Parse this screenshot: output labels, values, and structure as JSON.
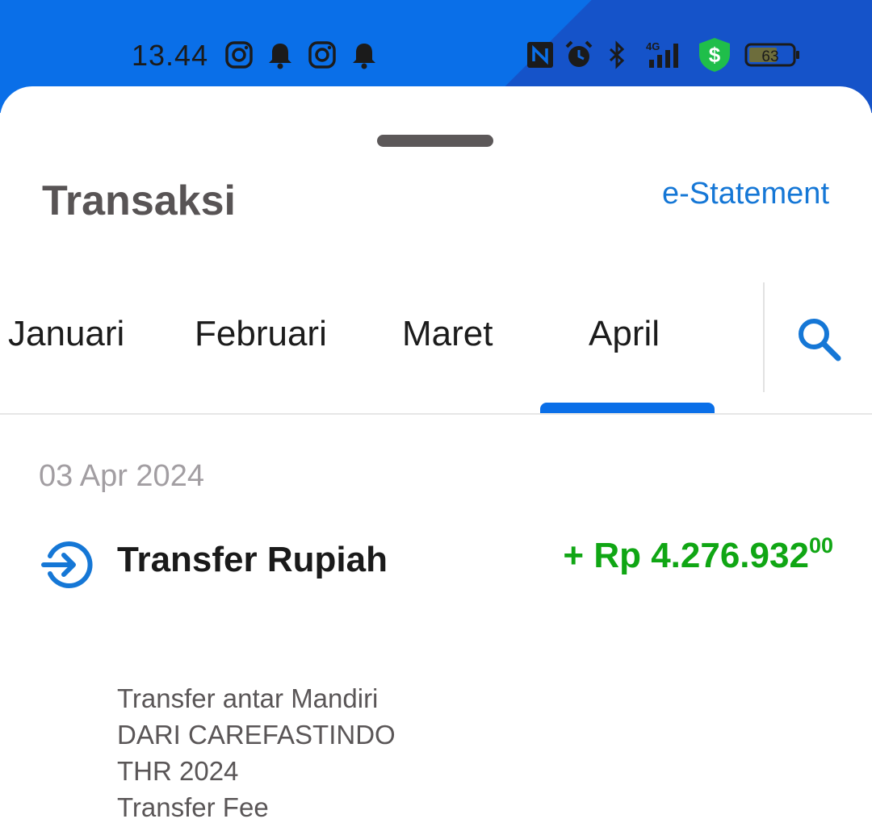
{
  "status_bar": {
    "time": "13.44",
    "battery": "63",
    "network": "4G",
    "icons": [
      "instagram-icon",
      "notification-bell-icon",
      "instagram-icon",
      "notification-bell-icon",
      "nfc-icon",
      "alarm-icon",
      "bluetooth-icon",
      "signal-icon",
      "money-shield-icon",
      "battery-icon"
    ]
  },
  "header": {
    "title": "Transaksi",
    "link_label": "e-Statement"
  },
  "tabs": [
    {
      "label": "Januari"
    },
    {
      "label": "Februari"
    },
    {
      "label": "Maret"
    },
    {
      "label": "April",
      "active": true
    }
  ],
  "transactions": {
    "date": "03 Apr 2024",
    "items": [
      {
        "title": "Transfer Rupiah",
        "amount_main": "+ Rp 4.276.932",
        "amount_cents": "00",
        "description": [
          "Transfer antar Mandiri",
          "DARI CAREFASTINDO",
          "THR 2024",
          "Transfer Fee"
        ]
      }
    ]
  },
  "colors": {
    "accent": "#0a6fe8",
    "link": "#1577d6",
    "credit": "#10a614",
    "title": "#585455"
  }
}
